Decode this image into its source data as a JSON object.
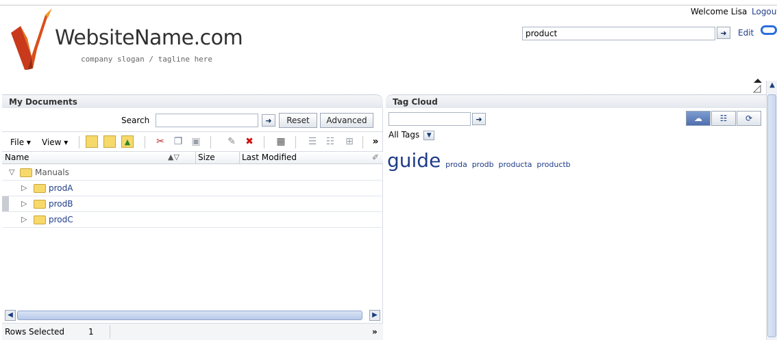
{
  "header": {
    "logo": {
      "name_part1": "Website",
      "name_part2": "Name.com",
      "tagline": "company slogan / tagline here"
    },
    "welcome": "Welcome Lisa",
    "logout": "Logout",
    "search_value": "product",
    "edit": "Edit"
  },
  "documents": {
    "title": "My Documents",
    "search_label": "Search",
    "search_value": "",
    "reset": "Reset",
    "advanced": "Advanced",
    "menus": {
      "file": "File",
      "view": "View"
    },
    "more": "»",
    "columns": {
      "name": "Name",
      "size": "Size",
      "last_modified": "Last Modified"
    },
    "rows": [
      {
        "label": "Manuals"
      },
      {
        "label": "prodA"
      },
      {
        "label": "prodB"
      },
      {
        "label": "prodC"
      }
    ],
    "status": {
      "label": "Rows Selected",
      "count": "1"
    }
  },
  "tag_cloud": {
    "title": "Tag Cloud",
    "search_value": "",
    "filter": "All Tags",
    "tags": [
      {
        "text": "guide",
        "size": "big"
      },
      {
        "text": "proda",
        "size": "small"
      },
      {
        "text": "prodb",
        "size": "small"
      },
      {
        "text": "producta",
        "size": "small"
      },
      {
        "text": "productb",
        "size": "small"
      }
    ]
  },
  "colors": {
    "link": "#1f3c88",
    "folder": "#f6d96b",
    "accent": "#2a6edb"
  }
}
